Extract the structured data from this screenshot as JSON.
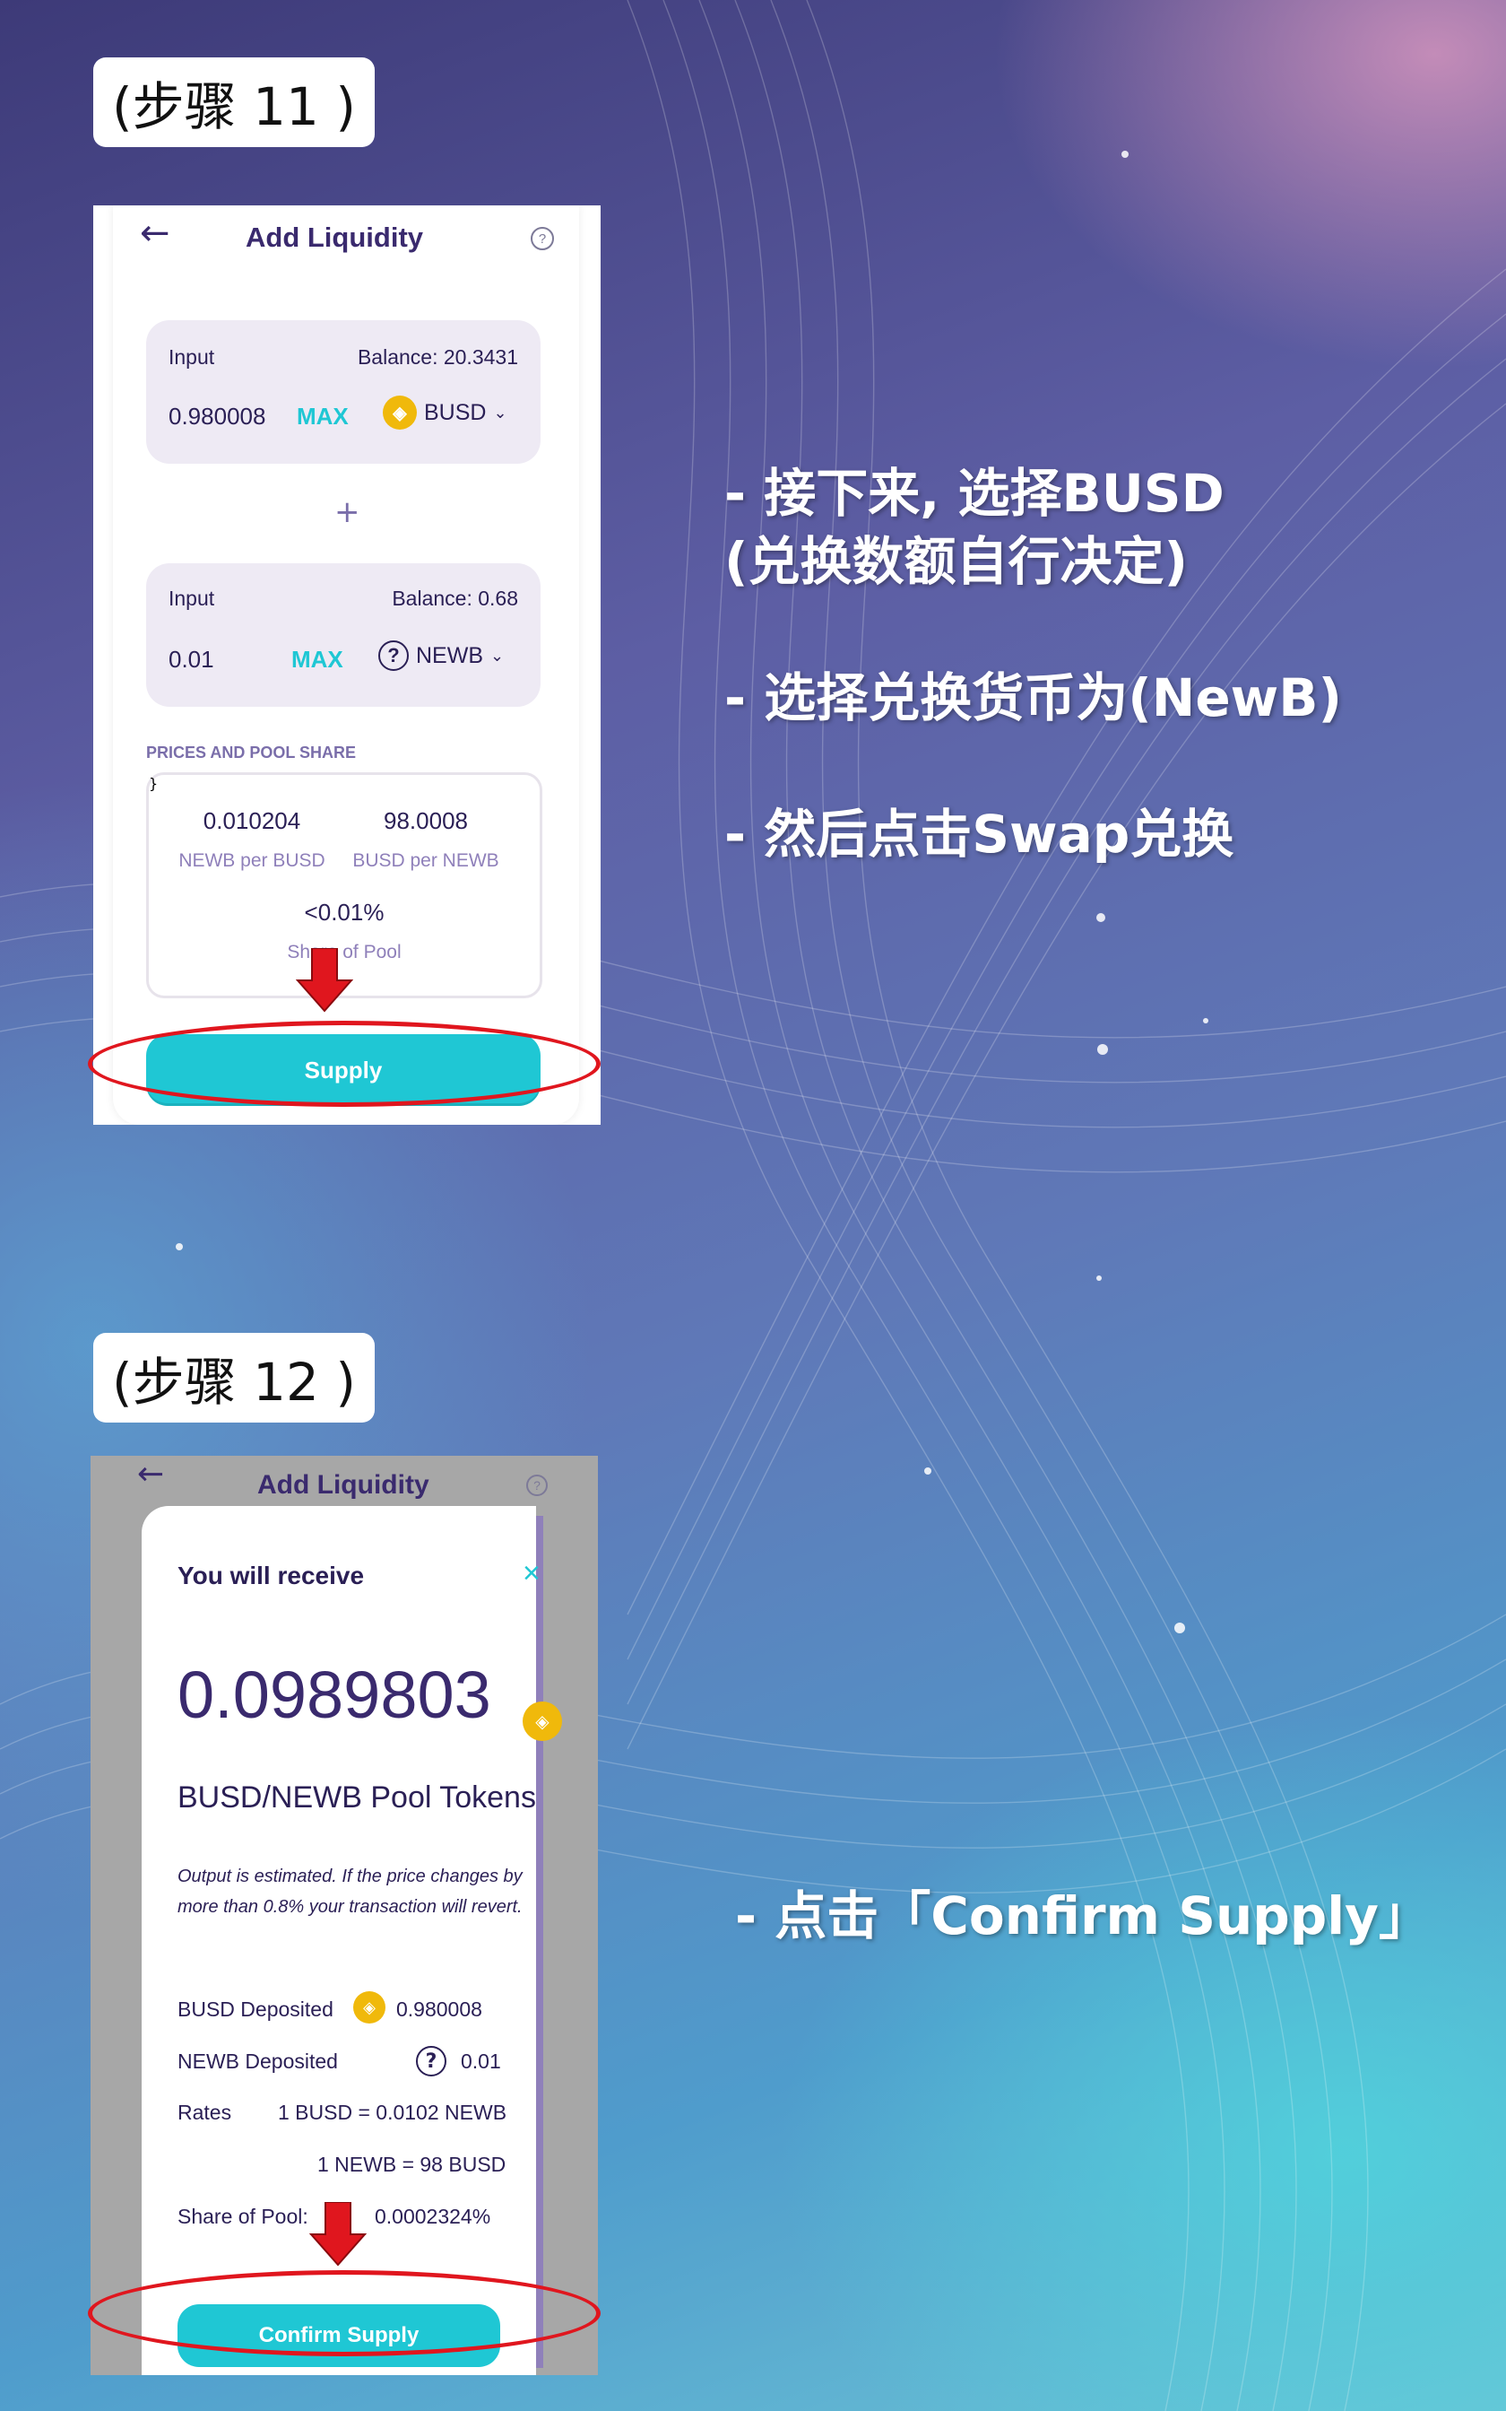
{
  "steps": {
    "step11": "(步骤 11 )",
    "step12": "(步骤 12 )"
  },
  "instructions": {
    "line1a": "-   接下来, 选择BUSD",
    "line1b": "(兑换数额自行决定)",
    "line2": "-   选择兑换货币为(NewB)",
    "line3": "-   然后点击Swap兑换",
    "line4": "-   点击「Confirm Supply」"
  },
  "screen1": {
    "back_icon": "←",
    "title": "Add Liquidity",
    "help_icon": "?",
    "input1": {
      "label": "Input",
      "balance": "Balance: 20.3431",
      "amount": "0.980008",
      "max": "MAX",
      "token": "BUSD",
      "token_icon": "busd-coin-icon"
    },
    "plus": "+",
    "input2": {
      "label": "Input",
      "balance": "Balance: 0.68",
      "amount": "0.01",
      "max": "MAX",
      "token": "NEWB",
      "token_icon": "question-coin-icon"
    },
    "prices_title": "PRICES AND POOL SHARE",
    "price1_value": "0.010204",
    "price1_label": "NEWB per BUSD",
    "price2_value": "98.0008",
    "price2_label": "BUSD per NEWB",
    "share_value": "<0.01%",
    "share_label": "Share of Pool",
    "supply": "Supply"
  },
  "screen2": {
    "back_icon": "←",
    "title": "Add Liquidity",
    "help_icon": "?",
    "heading": "You will receive",
    "close_icon": "×",
    "amount": "0.0989803",
    "pool_token": "BUSD/NEWB Pool Tokens",
    "note_line1": "Output is estimated. If the price changes by",
    "note_line2": "more than 0.8% your transaction will revert.",
    "busd_deposited_label": "BUSD Deposited",
    "busd_deposited_value": "0.980008",
    "newb_deposited_label": "NEWB Deposited",
    "newb_deposited_value": "0.01",
    "rates_label": "Rates",
    "rate1": "1 BUSD = 0.0102 NEWB",
    "rate2": "1 NEWB = 98 BUSD",
    "share_label": "Share of Pool:",
    "share_value": "0.0002324%",
    "confirm": "Confirm Supply"
  },
  "colors": {
    "accent": "#1fc7d4",
    "title": "#3a2a6e",
    "highlight": "#e0161e",
    "busd": "#f0b90b"
  }
}
